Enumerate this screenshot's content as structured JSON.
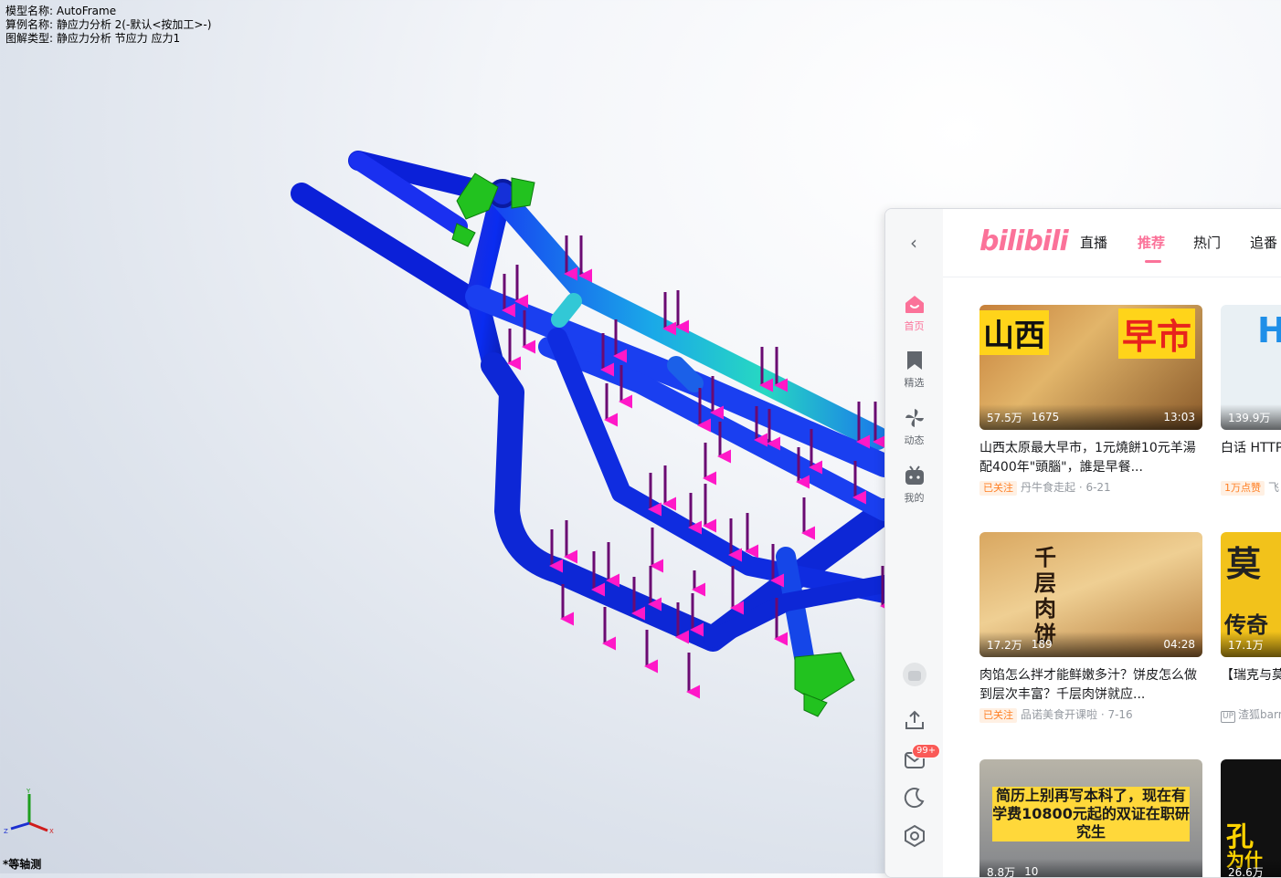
{
  "cad": {
    "model_name": "模型名称: AutoFrame",
    "study_name": "算例名称: 静应力分析 2(-默认<按加工>-)",
    "plot_type": "图解类型: 静应力分析 节应力 应力1",
    "view_label": "*等轴测",
    "triad": {
      "x": "X",
      "y": "Y",
      "z": "Z"
    }
  },
  "bili": {
    "logo": "bilibili",
    "tabs": [
      "直播",
      "推荐",
      "热门",
      "追番"
    ],
    "active_tab": "推荐",
    "nav": [
      {
        "label": "首页",
        "icon": "home-icon"
      },
      {
        "label": "精选",
        "icon": "bookmark-icon"
      },
      {
        "label": "动态",
        "icon": "pinwheel-icon"
      },
      {
        "label": "我的",
        "icon": "tv-icon"
      }
    ],
    "message_badge": "99+",
    "cards": [
      {
        "views": "57.5万",
        "danmaku": "1675",
        "duration": "13:03",
        "title": "山西太原最大早市，1元燒餅10元羊湯配400年\"頭腦\"，誰是早餐...",
        "tag": "已关注",
        "author": "丹牛食走起 · 6-21",
        "thumb_text_left": "山西",
        "thumb_text_right": "早市"
      },
      {
        "views": "139.9万",
        "danmaku": "",
        "duration": "",
        "title": "白话 HTTP 皮子底下安...",
        "tag": "1万点赞",
        "author": "飞",
        "thumb_text_left": "H",
        "thumb_text_right": ""
      },
      {
        "views": "17.2万",
        "danmaku": "189",
        "duration": "04:28",
        "title": "肉馅怎么拌才能鲜嫩多汁？饼皮怎么做到层次丰富？千层肉饼就应...",
        "tag": "已关注",
        "author": "品诺美食开课啦 · 7-16",
        "thumb_text_left": "千层肉饼",
        "thumb_text_right": ""
      },
      {
        "views": "17.1万",
        "danmaku": "",
        "duration": "",
        "title": "【瑞克与莫... 好恣但是内...",
        "tag": "",
        "author": "渣狐barn",
        "thumb_text_left": "莫",
        "thumb_text_right": "传奇"
      },
      {
        "views": "8.8万",
        "danmaku": "10",
        "duration": "",
        "title": "",
        "tag": "",
        "author": "",
        "thumb_text_left": "简历上别再写本科了，现在有学费10800元起的双证在职研究生",
        "thumb_text_right": ""
      },
      {
        "views": "26.6万",
        "danmaku": "",
        "duration": "",
        "title": "",
        "tag": "",
        "author": "",
        "thumb_text_left": "孔",
        "thumb_text_right": "为什"
      }
    ]
  }
}
